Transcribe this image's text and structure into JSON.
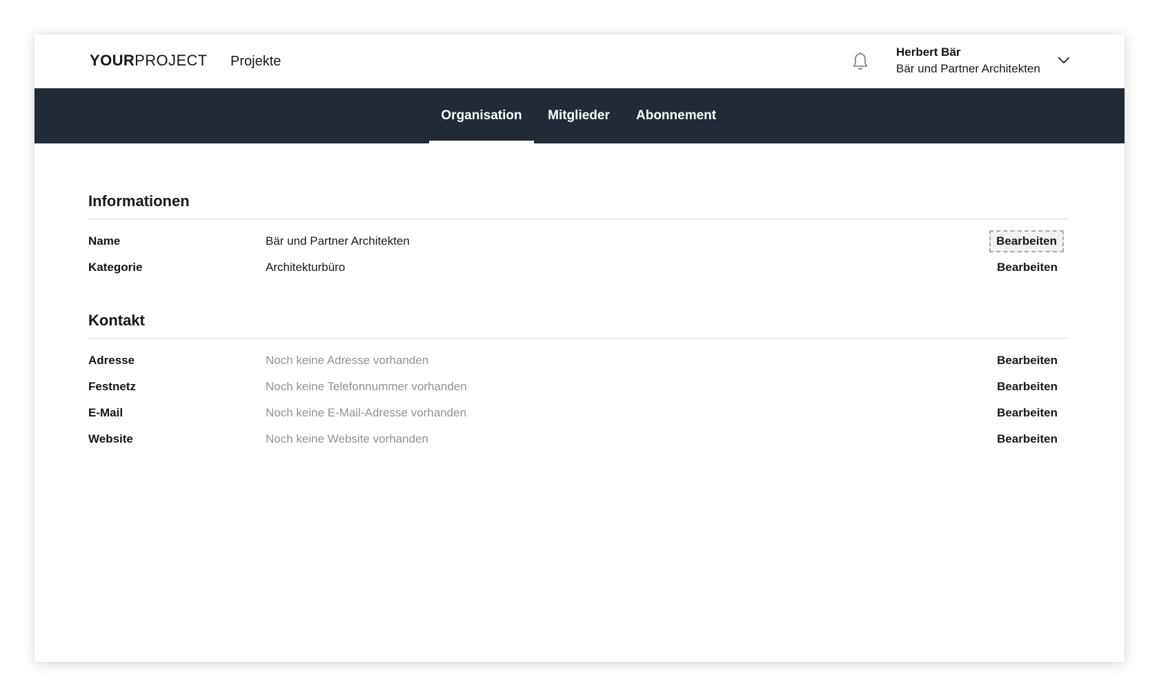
{
  "header": {
    "logo_bold": "YOUR",
    "logo_light": "PROJECT",
    "projects_link": "Projekte",
    "user_name": "Herbert Bär",
    "user_org": "Bär und Partner Architekten",
    "icons": {
      "notifications": "bell-icon",
      "user_menu": "chevron-down-icon"
    }
  },
  "nav": {
    "tabs": [
      {
        "label": "Organisation",
        "active": true
      },
      {
        "label": "Mitglieder",
        "active": false
      },
      {
        "label": "Abonnement",
        "active": false
      }
    ]
  },
  "informationen": {
    "title": "Informationen",
    "rows": [
      {
        "label": "Name",
        "value": "Bär und Partner Architekten",
        "action": "Bearbeiten"
      },
      {
        "label": "Kategorie",
        "value": "Architekturbüro",
        "action": "Bearbeiten"
      }
    ]
  },
  "kontakt": {
    "title": "Kontakt",
    "rows": [
      {
        "label": "Adresse",
        "value": "Noch keine Adresse vorhanden",
        "action": "Bearbeiten"
      },
      {
        "label": "Festnetz",
        "value": "Noch keine Telefonnummer vorhanden",
        "action": "Bearbeiten"
      },
      {
        "label": "E-Mail",
        "value": "Noch keine E-Mail-Adresse vorhanden",
        "action": "Bearbeiten"
      },
      {
        "label": "Website",
        "value": "Noch keine Website vorhanden",
        "action": "Bearbeiten"
      }
    ]
  },
  "colors": {
    "nav_background": "#222a35",
    "placeholder_text": "#8e9298",
    "divider": "#dadcdf"
  }
}
